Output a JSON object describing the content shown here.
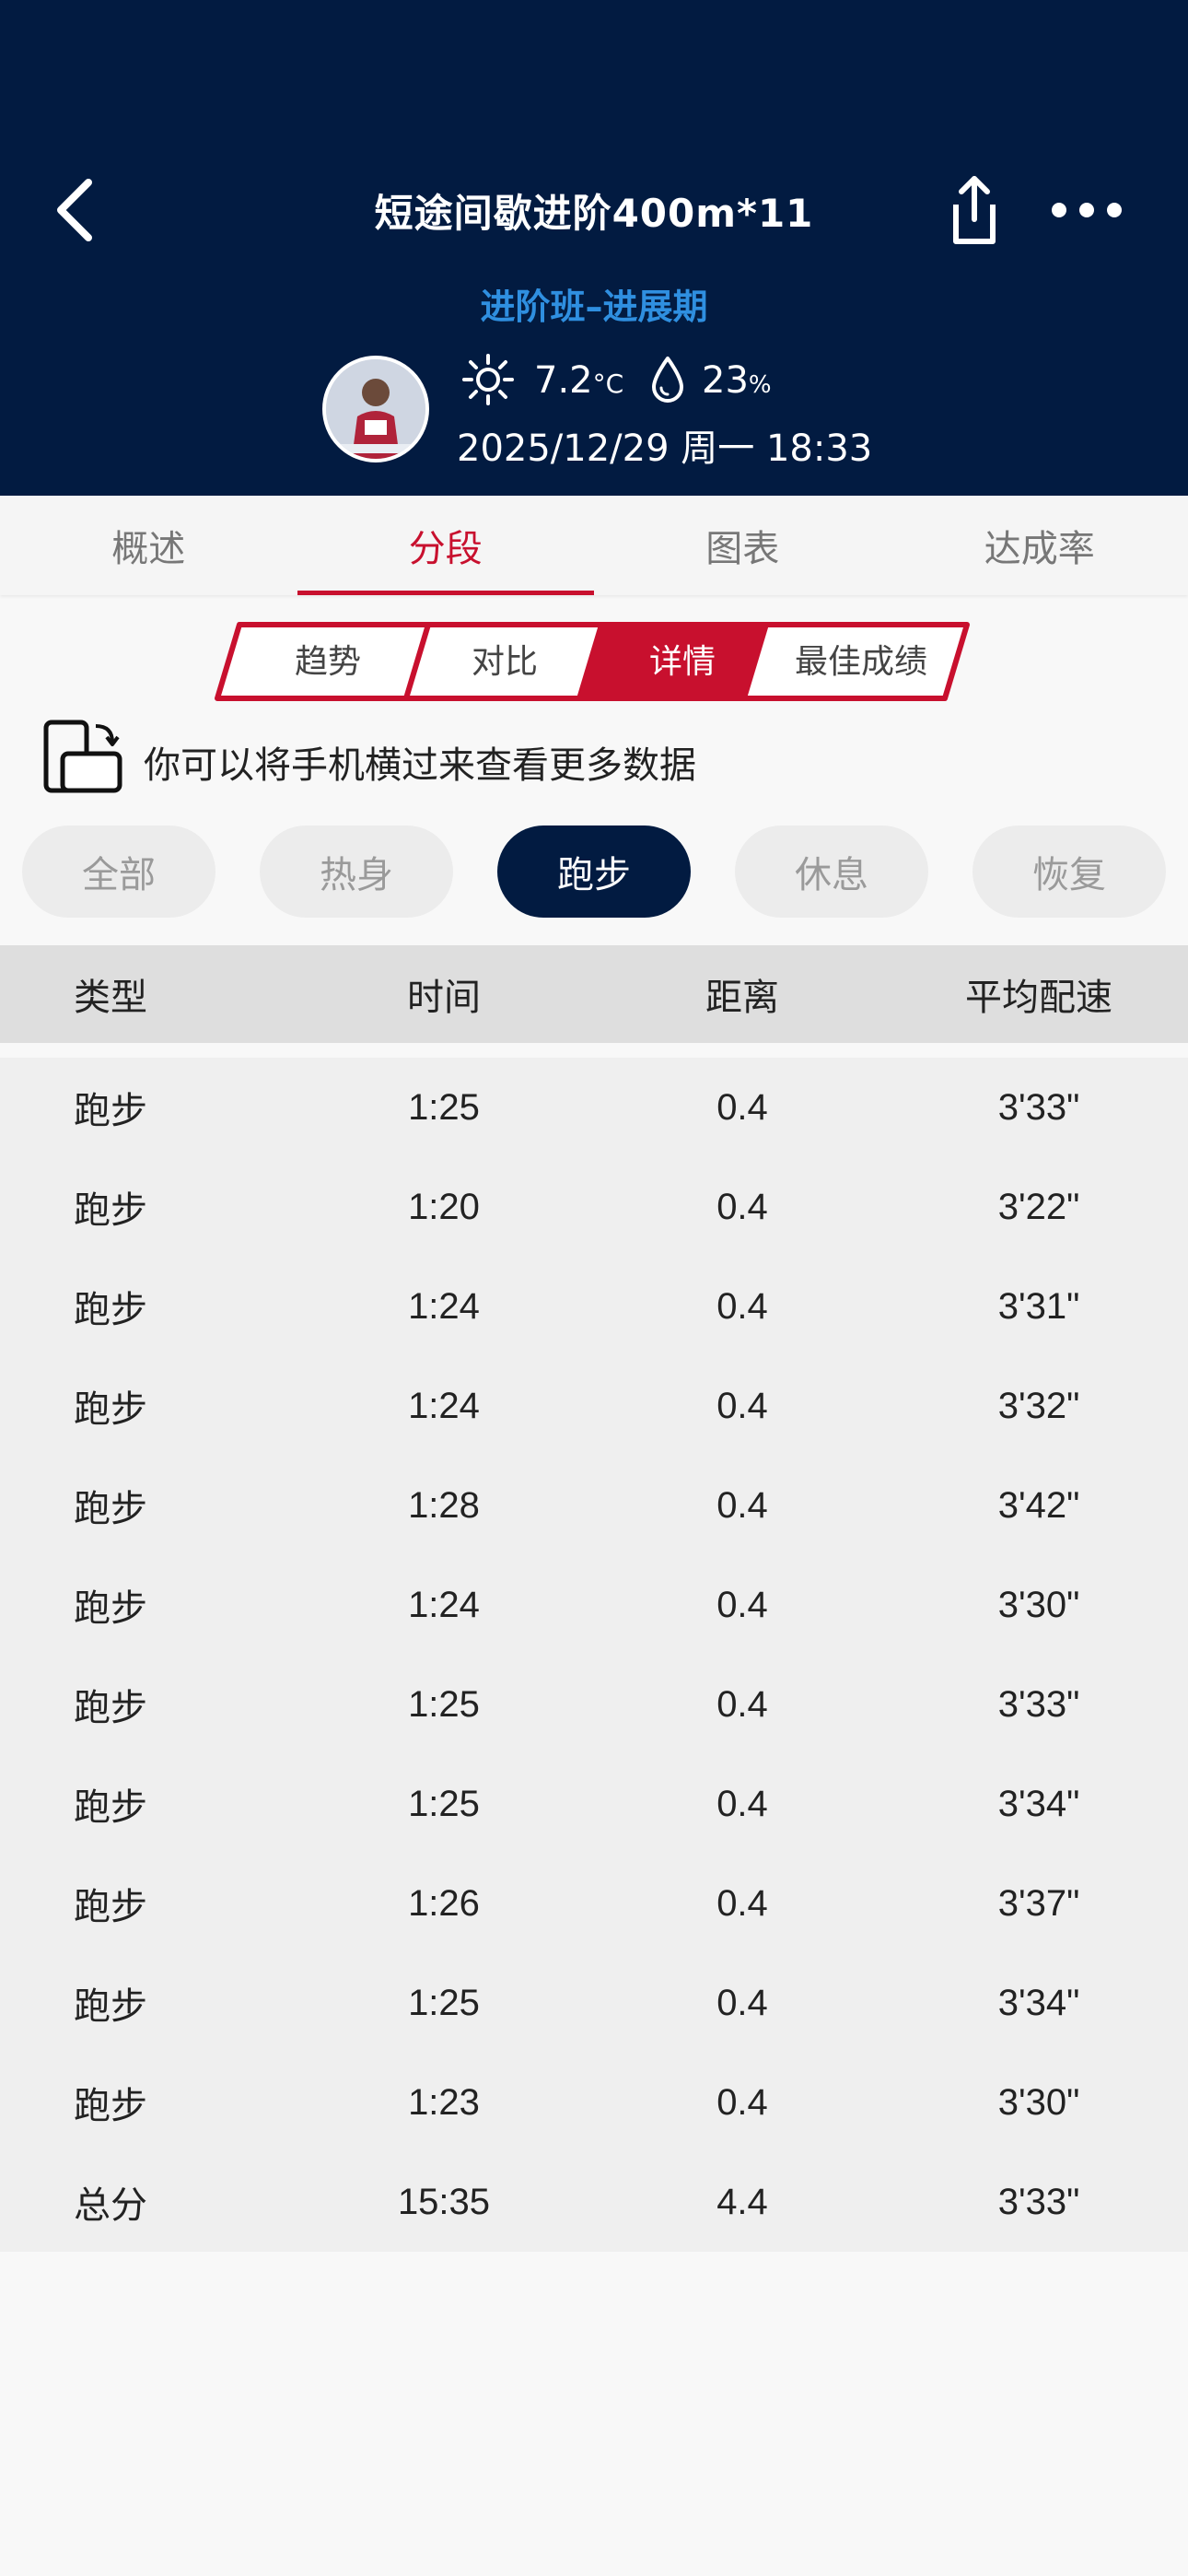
{
  "header": {
    "title": "短途间歇进阶400m*11",
    "subtitle": "进阶班–进展期",
    "temperature": "7.2",
    "temperature_unit": "°C",
    "humidity": "23",
    "humidity_unit": "%",
    "datetime": "2025/12/29 周一 18:33",
    "icons": [
      "chevron-left-icon",
      "share-icon",
      "more-icon",
      "sun-icon",
      "drop-icon"
    ]
  },
  "main_tabs": [
    {
      "label": "概述",
      "active": false
    },
    {
      "label": "分段",
      "active": true
    },
    {
      "label": "图表",
      "active": false
    },
    {
      "label": "达成率",
      "active": false
    }
  ],
  "segments": [
    {
      "label": "趋势",
      "active": false
    },
    {
      "label": "对比",
      "active": false
    },
    {
      "label": "详情",
      "active": true
    },
    {
      "label": "最佳成绩",
      "active": false
    }
  ],
  "hint": "你可以将手机横过来查看更多数据",
  "filters": [
    {
      "label": "全部",
      "active": false
    },
    {
      "label": "热身",
      "active": false
    },
    {
      "label": "跑步",
      "active": true
    },
    {
      "label": "休息",
      "active": false
    },
    {
      "label": "恢复",
      "active": false
    }
  ],
  "table": {
    "columns": [
      "类型",
      "时间",
      "距离",
      "平均配速"
    ],
    "rows": [
      [
        "跑步",
        "1:25",
        "0.4",
        "3'33\""
      ],
      [
        "跑步",
        "1:20",
        "0.4",
        "3'22\""
      ],
      [
        "跑步",
        "1:24",
        "0.4",
        "3'31\""
      ],
      [
        "跑步",
        "1:24",
        "0.4",
        "3'32\""
      ],
      [
        "跑步",
        "1:28",
        "0.4",
        "3'42\""
      ],
      [
        "跑步",
        "1:24",
        "0.4",
        "3'30\""
      ],
      [
        "跑步",
        "1:25",
        "0.4",
        "3'33\""
      ],
      [
        "跑步",
        "1:25",
        "0.4",
        "3'34\""
      ],
      [
        "跑步",
        "1:26",
        "0.4",
        "3'37\""
      ],
      [
        "跑步",
        "1:25",
        "0.4",
        "3'34\""
      ],
      [
        "跑步",
        "1:23",
        "0.4",
        "3'30\""
      ],
      [
        "总分",
        "15:35",
        "4.4",
        "3'33\""
      ]
    ]
  },
  "colors": {
    "header_bg": "#021b41",
    "accent_red": "#c8102e",
    "subtitle_blue": "#2f8fe0"
  }
}
